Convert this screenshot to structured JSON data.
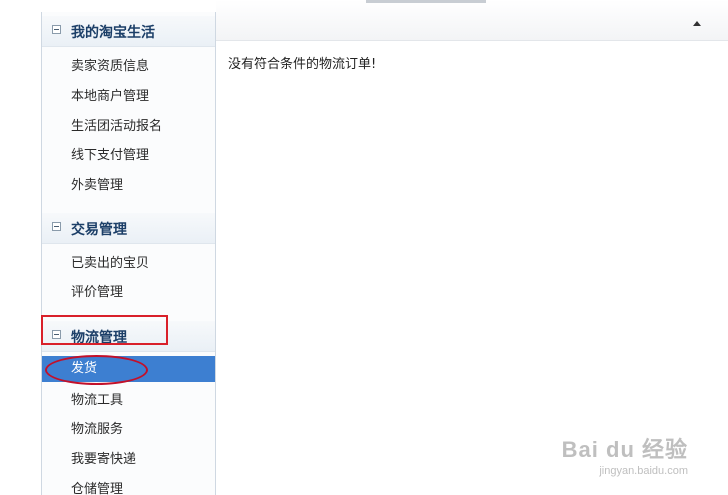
{
  "sidebar": {
    "groups": [
      {
        "title": "我的淘宝生活",
        "items": [
          "卖家资质信息",
          "本地商户管理",
          "生活团活动报名",
          "线下支付管理",
          "外卖管理"
        ]
      },
      {
        "title": "交易管理",
        "items": [
          "已卖出的宝贝",
          "评价管理"
        ]
      },
      {
        "title": "物流管理",
        "items": [
          "发货",
          "物流工具",
          "物流服务",
          "我要寄快递",
          "仓储管理"
        ]
      }
    ],
    "active_item": "发货"
  },
  "main": {
    "empty_message": "没有符合条件的物流订单!"
  },
  "watermark": {
    "text": "Bai du 经验",
    "url": "jingyan.baidu.com"
  },
  "colors": {
    "active_bg": "#3d7fd1",
    "highlight": "#d9202a",
    "group_title": "#1c3f68"
  },
  "icons": {
    "group_toggle": "collapse-minus-icon",
    "scroll": "scroll-up-arrow-icon"
  }
}
